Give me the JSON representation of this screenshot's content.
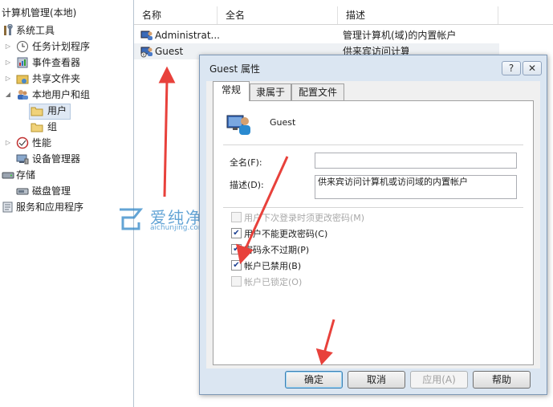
{
  "tree": {
    "items": [
      {
        "label": "计算机管理(本地)",
        "icon": "computer-management-icon"
      },
      {
        "label": "系统工具",
        "icon": "tools-icon"
      },
      {
        "label": "任务计划程序",
        "icon": "clock-icon"
      },
      {
        "label": "事件查看器",
        "icon": "event-viewer-icon"
      },
      {
        "label": "共享文件夹",
        "icon": "shared-folder-icon"
      },
      {
        "label": "本地用户和组",
        "icon": "users-icon"
      },
      {
        "label": "用户",
        "icon": "folder-icon"
      },
      {
        "label": "组",
        "icon": "folder-icon"
      },
      {
        "label": "性能",
        "icon": "performance-icon"
      },
      {
        "label": "设备管理器",
        "icon": "device-manager-icon"
      },
      {
        "label": "存储",
        "icon": "storage-icon"
      },
      {
        "label": "磁盘管理",
        "icon": "disk-icon"
      },
      {
        "label": "服务和应用程序",
        "icon": "services-icon"
      }
    ]
  },
  "list": {
    "columns": [
      "名称",
      "全名",
      "描述"
    ],
    "rows": [
      {
        "name": "Administrat...",
        "fullname": "",
        "desc": "管理计算机(域)的内置帐户",
        "icon": "user-icon"
      },
      {
        "name": "Guest",
        "fullname": "",
        "desc": "供来宾访问计算机或访问域的内",
        "icon": "user-disabled-icon"
      }
    ]
  },
  "dialog": {
    "title": "Guest 属性",
    "help_glyph": "?",
    "close_glyph": "✕",
    "tabs": [
      "常规",
      "隶属于",
      "配置文件"
    ],
    "user_name": "Guest",
    "fullname_label": "全名(F):",
    "fullname_value": "",
    "desc_label": "描述(D):",
    "desc_value": "供来宾访问计算机或访问域的内置帐户",
    "checkboxes": [
      {
        "label": "用户下次登录时须更改密码(M)",
        "checked": false,
        "disabled": true
      },
      {
        "label": "用户不能更改密码(C)",
        "checked": true,
        "disabled": false
      },
      {
        "label": "密码永不过期(P)",
        "checked": true,
        "disabled": false
      },
      {
        "label": "帐户已禁用(B)",
        "checked": true,
        "disabled": false
      },
      {
        "label": "帐户已锁定(O)",
        "checked": false,
        "disabled": true
      }
    ],
    "buttons": {
      "ok": "确定",
      "cancel": "取消",
      "apply": "应用(A)",
      "help": "帮助"
    }
  },
  "watermark": {
    "brand": "爱纯净",
    "url": "aichunjing.com"
  },
  "colors": {
    "accent": "#2f86c8",
    "arrow": "#e8413b",
    "selection": "#dfe8f4"
  }
}
